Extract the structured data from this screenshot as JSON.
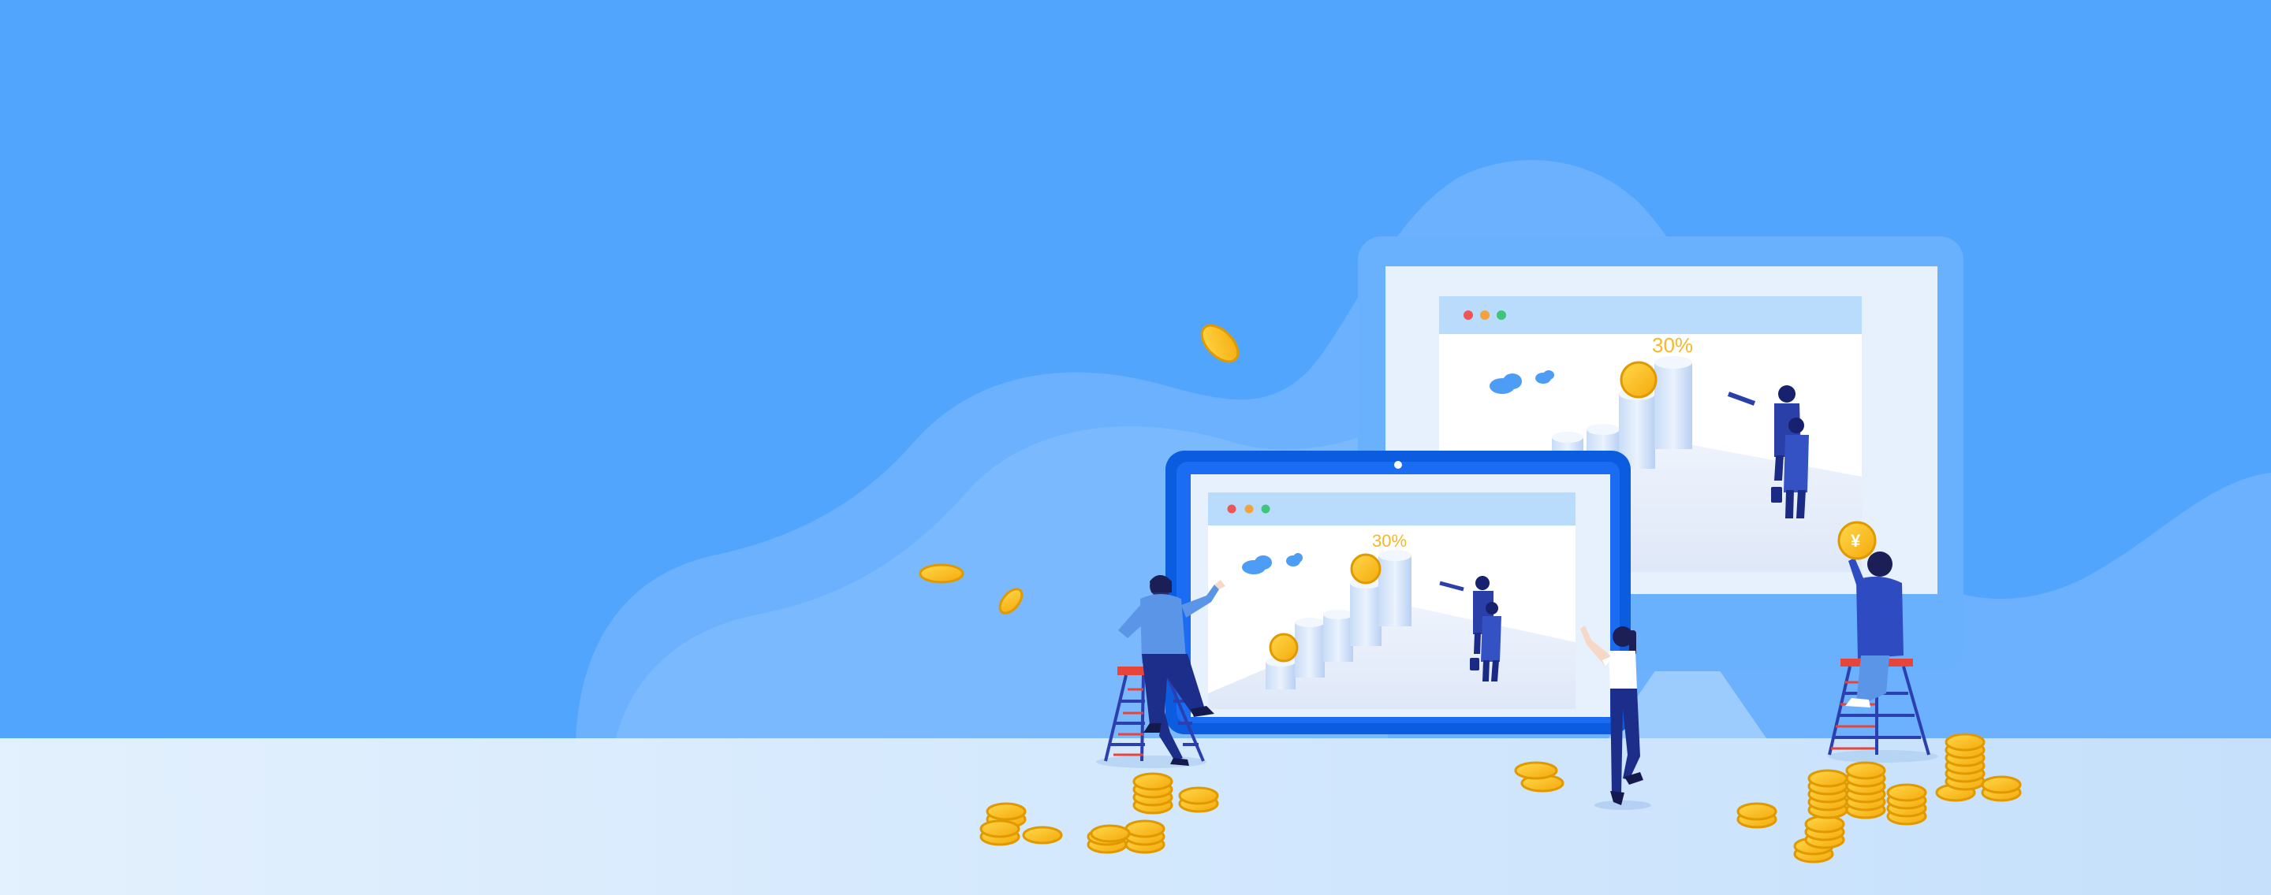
{
  "scene": {
    "big_monitor": {
      "chart_label": "30%"
    },
    "tablet": {
      "chart_label": "30%"
    },
    "held_coin": {
      "symbol": "¥"
    },
    "colors": {
      "sky": "#52a5fd",
      "floor": "#c9e2fc",
      "coin": "#ffc21a",
      "device_frame": "#0c5ce0",
      "figure": "#1d2e8a",
      "ladder_top": "#e8453a",
      "window_dot_red": "#f05454",
      "window_dot_orange": "#f3a33b",
      "window_dot_green": "#3fc47c"
    }
  }
}
